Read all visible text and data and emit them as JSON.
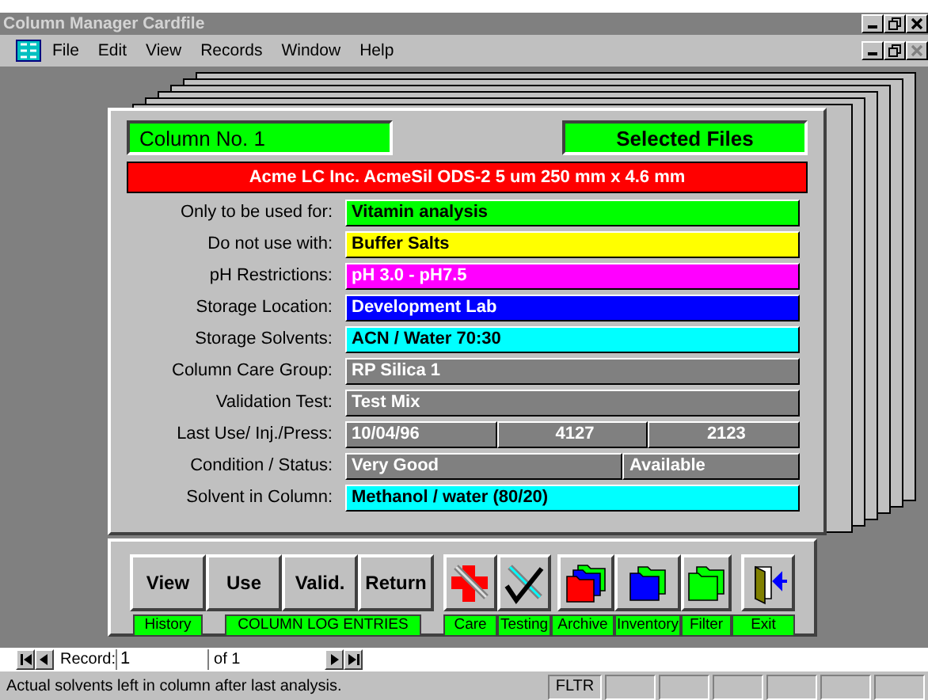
{
  "window": {
    "title": "Column Manager Cardfile"
  },
  "menu": {
    "items": [
      "File",
      "Edit",
      "View",
      "Records",
      "Window",
      "Help"
    ]
  },
  "card": {
    "column_no": "Column No.  1",
    "selected_files": "Selected Files",
    "header": "Acme LC Inc.  AcmeSil  ODS-2  5 um 250 mm x 4.6 mm",
    "fields": [
      {
        "label": "Only to be used for:",
        "values": [
          "Vitamin analysis"
        ],
        "color": "#00ff00"
      },
      {
        "label": "Do not use with:",
        "values": [
          "Buffer Salts"
        ],
        "color": "#ffff00"
      },
      {
        "label": "pH Restrictions:",
        "values": [
          "pH 3.0 - pH7.5"
        ],
        "color": "#ff00ff"
      },
      {
        "label": "Storage Location:",
        "values": [
          "Development Lab"
        ],
        "color": "#0000ff"
      },
      {
        "label": "Storage Solvents:",
        "values": [
          "ACN / Water 70:30"
        ],
        "color": "#00ffff"
      },
      {
        "label": "Column Care Group:",
        "values": [
          "RP Silica 1"
        ],
        "color": "#808080"
      },
      {
        "label": "Validation Test:",
        "values": [
          "Test Mix"
        ],
        "color": "#808080"
      },
      {
        "label": "Last Use/ Inj./Press:",
        "values": [
          "10/04/96",
          "4127",
          "2123"
        ],
        "color": "#808080"
      },
      {
        "label": "Condition / Status:",
        "values": [
          "Very Good",
          "Available"
        ],
        "color": "#808080"
      },
      {
        "label": "Solvent in Column:",
        "values": [
          "Methanol / water (80/20)"
        ],
        "color": "#00ffff"
      }
    ]
  },
  "toolbar": {
    "log_buttons": [
      "View",
      "Use",
      "Valid.",
      "Return"
    ],
    "captions": [
      "History",
      "COLUMN LOG ENTRIES"
    ],
    "tools": [
      {
        "kind": "care",
        "caption": "Care"
      },
      {
        "kind": "testing",
        "caption": "Testing"
      },
      {
        "kind": "archive",
        "caption": "Archive"
      },
      {
        "kind": "inventory",
        "caption": "Inventory"
      },
      {
        "kind": "filter",
        "caption": "Filter"
      },
      {
        "kind": "exit",
        "caption": "Exit"
      }
    ]
  },
  "navigator": {
    "label": "Record:",
    "record": "1",
    "of": "of  1"
  },
  "status_bar": {
    "text": "Actual solvents left in column after last analysis.",
    "indicator": "FLTR"
  }
}
